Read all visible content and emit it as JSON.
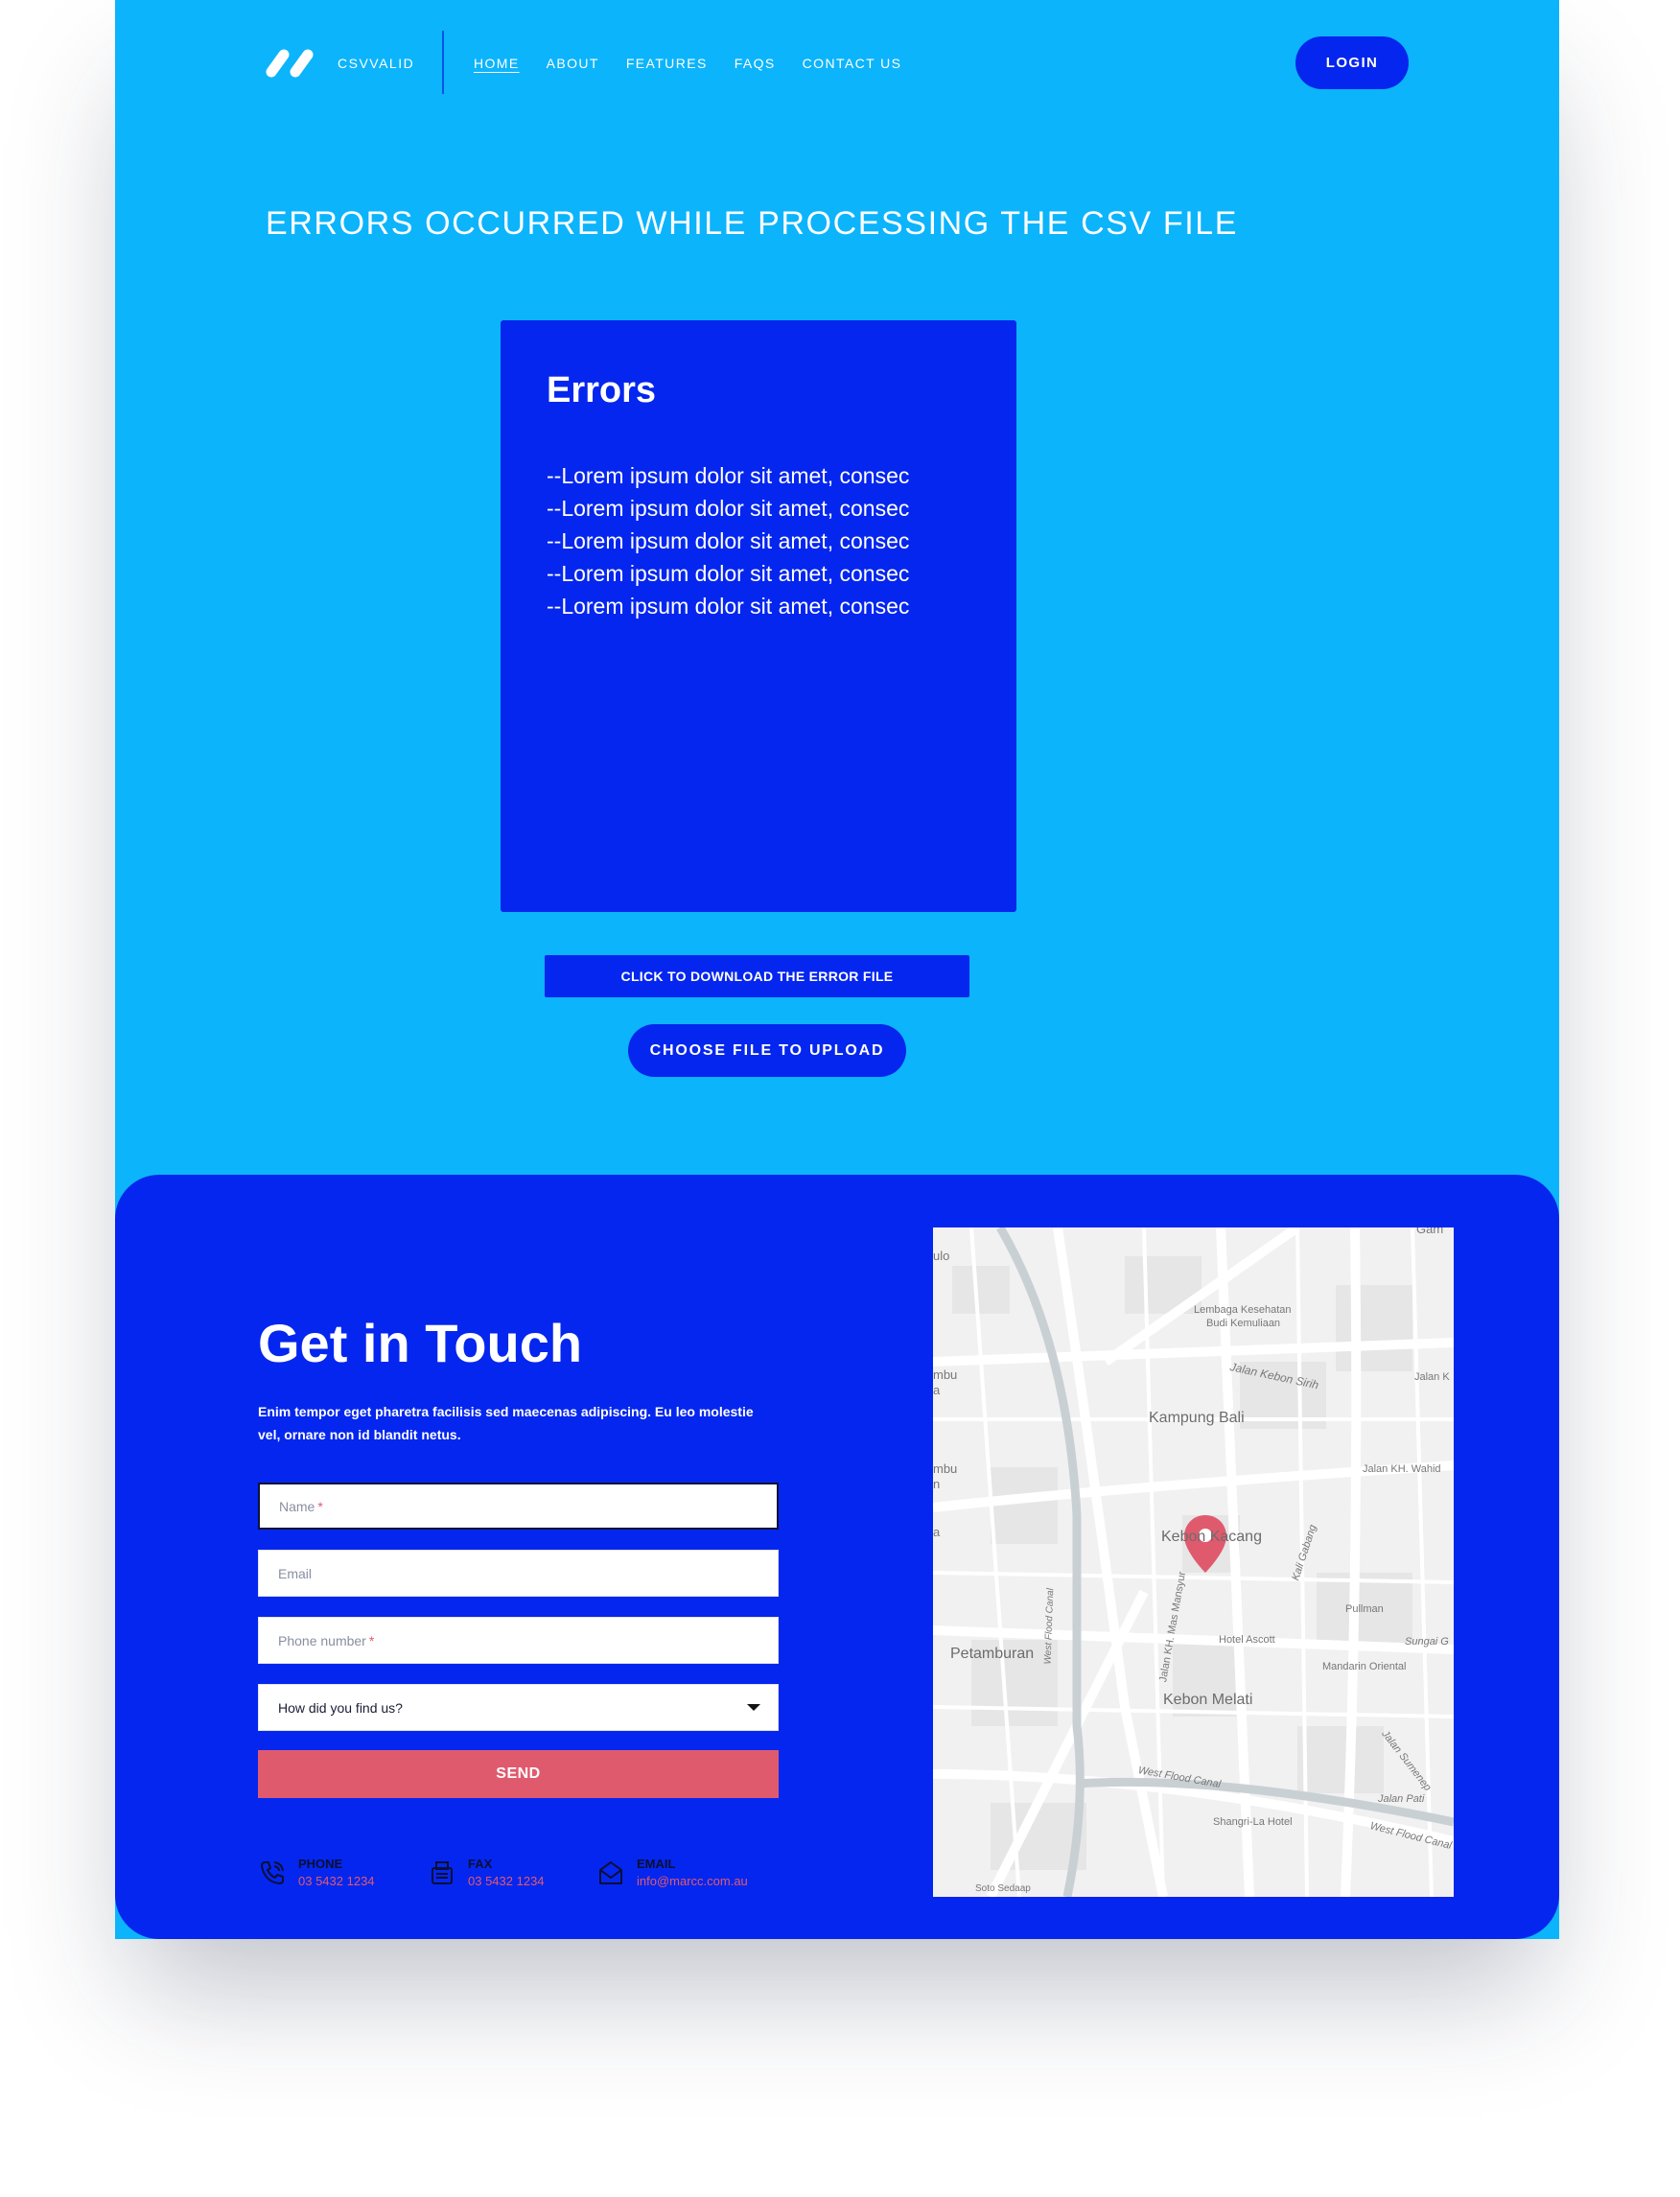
{
  "header": {
    "brand": "CSVVALID",
    "nav": [
      {
        "label": "HOME",
        "active": true
      },
      {
        "label": "ABOUT"
      },
      {
        "label": "FEATURES"
      },
      {
        "label": "FAQS"
      },
      {
        "label": "CONTACT US"
      }
    ],
    "login_label": "LOGIN"
  },
  "main": {
    "heading": "ERRORS OCCURRED WHILE PROCESSING THE CSV FILE",
    "errors_title": "Errors",
    "errors": [
      "--Lorem ipsum dolor sit amet, consec",
      "--Lorem ipsum dolor sit amet, consec",
      "--Lorem ipsum dolor sit amet, consec",
      "--Lorem ipsum dolor sit amet, consec",
      "--Lorem ipsum dolor sit amet, consec"
    ],
    "download_label": "CLICK TO DOWNLOAD THE ERROR FILE",
    "upload_label": "CHOOSE FILE TO UPLOAD"
  },
  "contact": {
    "title": "Get in Touch",
    "description": "Enim tempor eget pharetra facilisis sed maecenas adipiscing. Eu leo molestie vel, ornare non id blandit netus.",
    "form": {
      "name_placeholder": "Name",
      "email_placeholder": "Email",
      "phone_placeholder": "Phone number",
      "source_selected": "How did you find us?",
      "required_mark": "*",
      "send_label": "SEND"
    },
    "info": {
      "phone_label": "PHONE",
      "phone_value": "03 5432 1234",
      "fax_label": "FAX",
      "fax_value": "03 5432 1234",
      "email_label": "EMAIL",
      "email_value": "info@marcc.com.au"
    },
    "map_labels": {
      "lembaga": "Lembaga Kesehatan",
      "budi": "Budi Kemuliaan",
      "kebon_sirih": "Jalan Kebon Sirih",
      "jalan_k": "Jalan K",
      "kampung_bali": "Kampung Bali",
      "wahid": "Jalan KH. Wahid",
      "kebon_kacang": "Kebon Kacang",
      "kali_gabang": "Kali Gabang",
      "pullman": "Pullman",
      "mas_mansyur": "Jalan KH. Mas Mansyur",
      "west_flood_canal": "West Flood Canal",
      "hotel_ascott": "Hotel Ascott",
      "sungai": "Sungai G",
      "petamburan": "Petamburan",
      "mandarin": "Mandarin Oriental",
      "kebon_melati": "Kebon Melati",
      "sumenep": "Jalan Sumenep",
      "jalan_pati": "Jalan Pati",
      "west_flood_canal_2": "West Flood Canal",
      "west_flood_canal_3": "West Flood Canal",
      "shangri": "Shangri-La Hotel",
      "soto": "Soto Sedaap",
      "ulo": "ulo",
      "mbu1": "mbu",
      "mbu2": "mbu",
      "gam": "Gam",
      "a1": "a",
      "a2": "a",
      "n1": "n"
    }
  }
}
